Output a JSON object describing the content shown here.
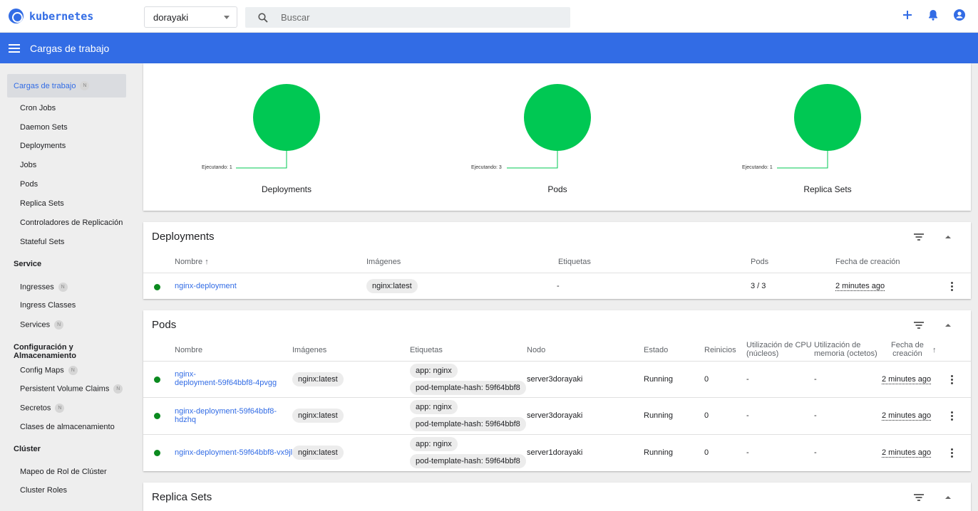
{
  "app": {
    "logo_text": "kubernetes"
  },
  "namespace": {
    "value": "dorayaki"
  },
  "search": {
    "placeholder": "Buscar"
  },
  "header": {
    "title": "Cargas de trabajo"
  },
  "sidebar": {
    "active": {
      "label": "Cargas de trabajo",
      "badge": "N"
    },
    "workloads": [
      "Cron Jobs",
      "Daemon Sets",
      "Deployments",
      "Jobs",
      "Pods",
      "Replica Sets",
      "Controladores de Replicación",
      "Stateful Sets"
    ],
    "service_head": "Service",
    "service_items": [
      {
        "label": "Ingresses",
        "badge": "N"
      },
      {
        "label": "Ingress Classes",
        "badge": ""
      },
      {
        "label": "Services",
        "badge": "N"
      }
    ],
    "config_head": "Configuración y Almacenamiento",
    "config_items": [
      {
        "label": "Config Maps",
        "badge": "N"
      },
      {
        "label": "Persistent Volume Claims",
        "badge": "N"
      },
      {
        "label": "Secretos",
        "badge": "N"
      },
      {
        "label": "Clases de almacenamiento",
        "badge": ""
      }
    ],
    "cluster_head": "Clúster",
    "cluster_items": [
      "Mapeo de Rol de Clúster",
      "Cluster Roles"
    ]
  },
  "summary": {
    "circles": [
      {
        "label": "Deployments",
        "running": "Ejecutando: 1"
      },
      {
        "label": "Pods",
        "running": "Ejecutando: 3"
      },
      {
        "label": "Replica Sets",
        "running": "Ejecutando: 1"
      }
    ],
    "color": "#00c853"
  },
  "deployments": {
    "title": "Deployments",
    "headers": {
      "name": "Nombre",
      "images": "Imágenes",
      "labels": "Etiquetas",
      "pods": "Pods",
      "created": "Fecha de creación"
    },
    "rows": [
      {
        "name": "nginx-deployment",
        "image": "nginx:latest",
        "labels": "-",
        "pods": "3 / 3",
        "created": "2 minutes ago"
      }
    ]
  },
  "pods": {
    "title": "Pods",
    "headers": {
      "name": "Nombre",
      "images": "Imágenes",
      "labels": "Etiquetas",
      "node": "Nodo",
      "status": "Estado",
      "restarts": "Reinicios",
      "cpu1": "Utilización de CPU",
      "cpu2": "(núcleos)",
      "mem1": "Utilización de",
      "mem2": "memoria (octetos)",
      "created1": "Fecha de",
      "created2": "creación"
    },
    "rows": [
      {
        "name1": "nginx-",
        "name2": "deployment-59f64bbf8-4pvgg",
        "image": "nginx:latest",
        "label1": "app: nginx",
        "label2": "pod-template-hash: 59f64bbf8",
        "node": "server3dorayaki",
        "status": "Running",
        "restarts": "0",
        "cpu": "-",
        "mem": "-",
        "created": "2 minutes ago"
      },
      {
        "name1": "nginx-deployment-59f64bbf8-",
        "name2": "hdzhq",
        "image": "nginx:latest",
        "label1": "app: nginx",
        "label2": "pod-template-hash: 59f64bbf8",
        "node": "server3dorayaki",
        "status": "Running",
        "restarts": "0",
        "cpu": "-",
        "mem": "-",
        "created": "2 minutes ago"
      },
      {
        "name1": "nginx-deployment-59f64bbf8-vx9jl",
        "name2": "",
        "image": "nginx:latest",
        "label1": "app: nginx",
        "label2": "pod-template-hash: 59f64bbf8",
        "node": "server1dorayaki",
        "status": "Running",
        "restarts": "0",
        "cpu": "-",
        "mem": "-",
        "created": "2 minutes ago"
      }
    ]
  },
  "replicasets": {
    "title": "Replica Sets"
  }
}
